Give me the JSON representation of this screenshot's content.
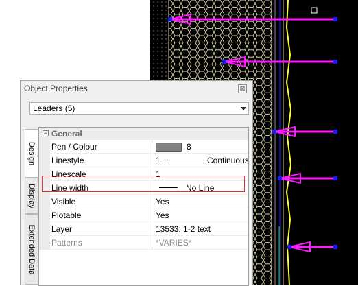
{
  "panel": {
    "title": "Object Properties",
    "close_glyph": "⊠",
    "selector_value": "Leaders (5)"
  },
  "tabs": [
    {
      "label": "Design",
      "active": true
    },
    {
      "label": "Display",
      "active": false
    },
    {
      "label": "Extended Data",
      "active": false
    }
  ],
  "group": {
    "toggle": "−",
    "label": "General"
  },
  "properties": {
    "pen_colour": {
      "name": "Pen / Colour",
      "value": "8",
      "swatch_color": "#808080"
    },
    "linestyle": {
      "name": "Linestyle",
      "value_num": "1",
      "value_name": "Continuous"
    },
    "linescale": {
      "name": "Linescale",
      "value": "1"
    },
    "line_width": {
      "name": "Line width",
      "value": "No Line"
    },
    "visible": {
      "name": "Visible",
      "value": "Yes"
    },
    "plotable": {
      "name": "Plotable",
      "value": "Yes"
    },
    "layer": {
      "name": "Layer",
      "value": "13533: 1-2 text"
    },
    "patterns": {
      "name": "Patterns",
      "value": "*VARIES*"
    }
  },
  "colors": {
    "cad_background": "#000000",
    "hatch": "#d9d3a8",
    "leader_arrow": "#ff19ff",
    "leader_grip": "#1a1aff",
    "boundary_line": "#ffff44",
    "highlight_box": "#e03030"
  },
  "icons": {
    "close": "close-icon",
    "dropdown": "chevron-down-icon",
    "collapse": "collapse-icon"
  }
}
